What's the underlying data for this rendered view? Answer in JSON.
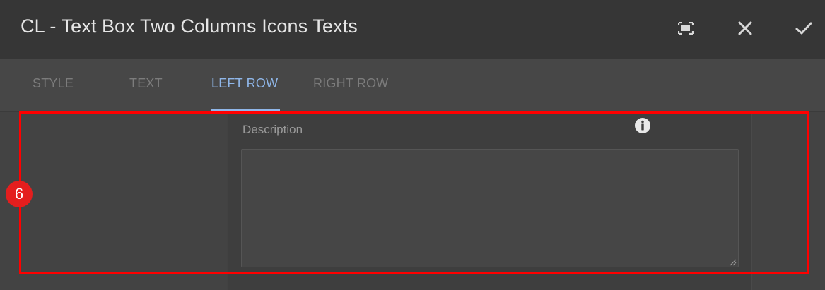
{
  "dialog": {
    "title": "CL - Text Box Two Columns Icons Texts",
    "buttons": {
      "fullscreen_icon": "fullscreen-icon",
      "close_icon": "close-icon",
      "confirm_icon": "checkmark-icon"
    }
  },
  "tabs": [
    {
      "label": "STYLE",
      "active": false
    },
    {
      "label": "TEXT",
      "active": false
    },
    {
      "label": "LEFT ROW",
      "active": true
    },
    {
      "label": "RIGHT ROW",
      "active": false
    }
  ],
  "form": {
    "description": {
      "label": "Description",
      "value": "",
      "info_icon": "info-icon"
    }
  },
  "annotation": {
    "callout_number": "6",
    "highlight_color": "#ff0000"
  },
  "colors": {
    "accent": "#8fb6e8",
    "titlebar_bg": "#363636",
    "tabs_bg": "#474747",
    "content_bg": "#424242"
  }
}
